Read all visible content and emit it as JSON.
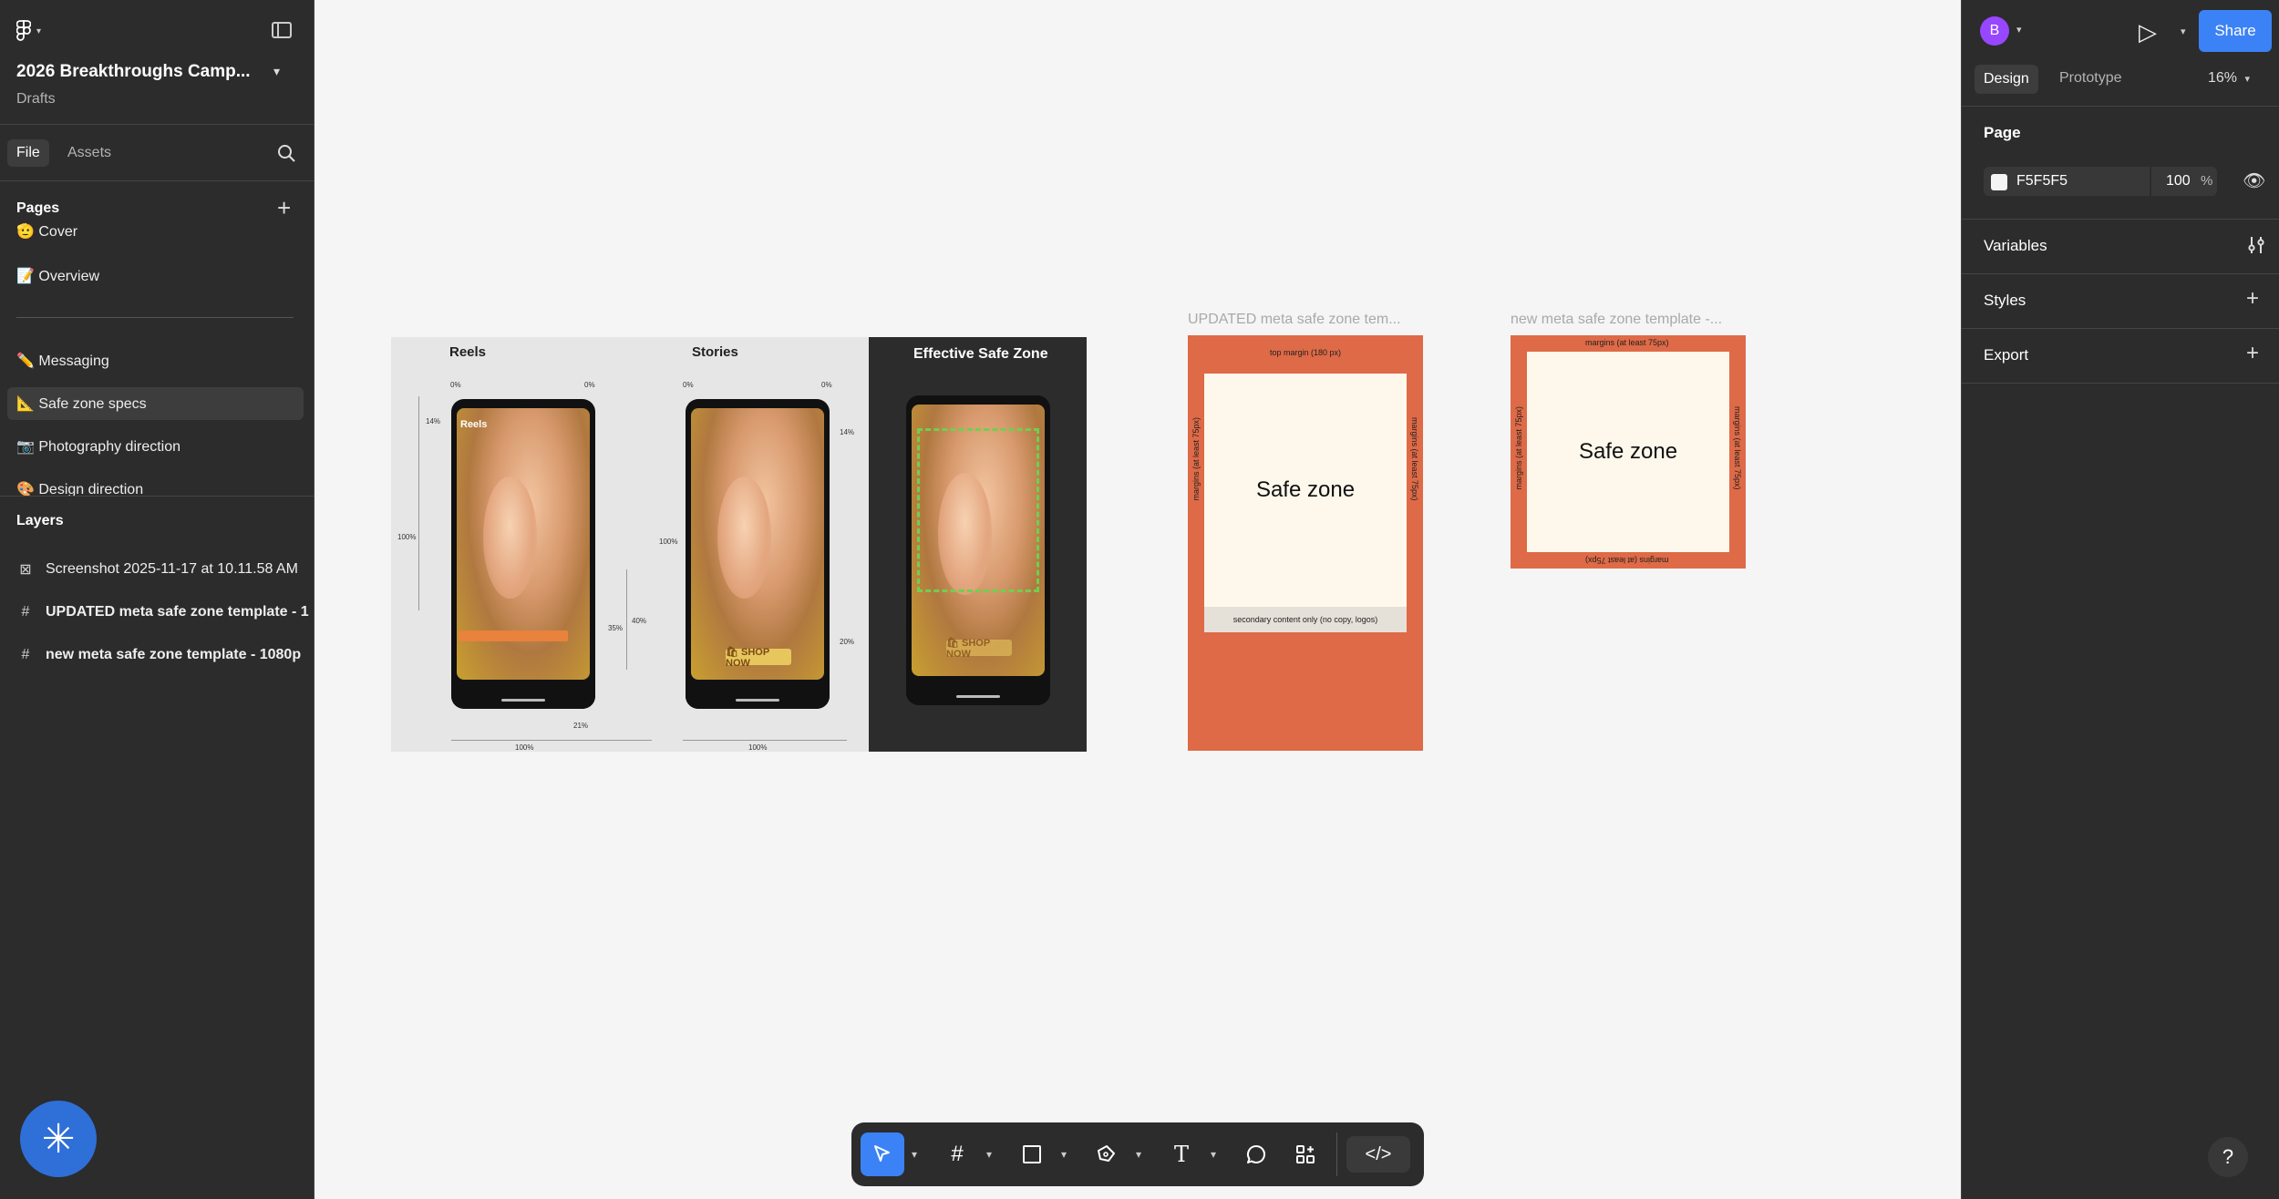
{
  "left_panel": {
    "file_title": "2026 Breakthroughs Camp...",
    "file_location": "Drafts",
    "tabs": {
      "file": "File",
      "assets": "Assets"
    },
    "pages_header": "Pages",
    "pages": [
      {
        "label": "🫡 Cover"
      },
      {
        "label": "📝 Overview"
      },
      {
        "label": "✏️ Messaging"
      },
      {
        "label": "📐 Safe zone specs"
      },
      {
        "label": "📷 Photography direction"
      },
      {
        "label": "🎨 Design direction"
      }
    ],
    "layers_header": "Layers",
    "layers": [
      {
        "icon": "image-icon",
        "label": "Screenshot 2025-11-17 at 10.11.58 AM"
      },
      {
        "icon": "frame-icon",
        "label": "UPDATED meta safe zone template - 1"
      },
      {
        "icon": "frame-icon",
        "label": "new meta safe zone template - 1080p"
      }
    ]
  },
  "canvas": {
    "frame_labels": {
      "updated": "UPDATED meta safe zone tem...",
      "new": "new meta safe zone template -..."
    },
    "screenshot": {
      "reels": "Reels",
      "stories": "Stories",
      "effective": "Effective Safe Zone",
      "reels_in_phone": "Reels",
      "shop_now": "🛍 SHOP NOW",
      "pcts": [
        "0%",
        "0%",
        "14%",
        "100%",
        "35%",
        "40%",
        "21%",
        "100%",
        "0%",
        "0%",
        "14%",
        "100%",
        "20%",
        "100%"
      ]
    },
    "updated_template": {
      "top_margin": "top margin (180 px)",
      "left_margin": "margins (at least 75px)",
      "right_margin": "margins (at least 75px)",
      "safe_zone": "Safe zone",
      "secondary": "secondary content only (no copy, logos)"
    },
    "new_template": {
      "top_margin": "margins (at least 75px)",
      "bottom_margin": "margins (at least 75px)",
      "left_margin": "margins (at least 75px)",
      "right_margin": "margins (at least 75px)",
      "safe_zone": "Safe zone"
    }
  },
  "right_panel": {
    "avatar_initial": "B",
    "share": "Share",
    "tabs": {
      "design": "Design",
      "prototype": "Prototype"
    },
    "zoom": "16%",
    "page_header": "Page",
    "page_color": "F5F5F5",
    "page_opacity": "100",
    "opacity_unit": "%",
    "variables": "Variables",
    "styles": "Styles",
    "export": "Export",
    "help": "?"
  },
  "colors": {
    "accent": "#3b82f6",
    "template_orange": "#de6a47",
    "safe_cream": "#fef8ec",
    "panel_bg": "#2c2c2c",
    "canvas_bg": "#f5f5f5"
  }
}
